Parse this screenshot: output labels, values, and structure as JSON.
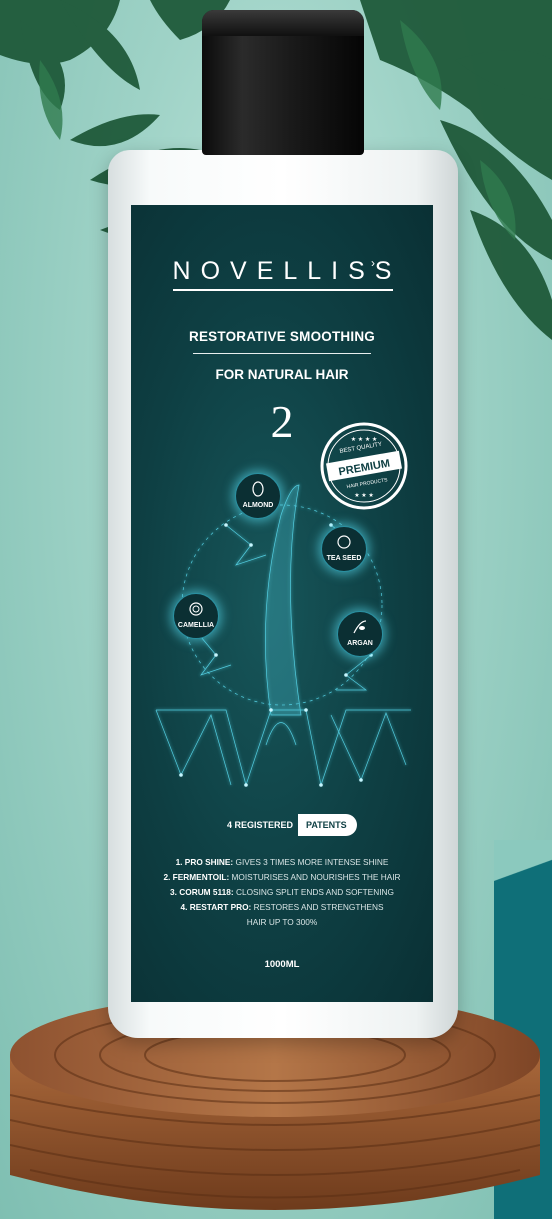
{
  "product": {
    "brand": "NOVELLISS",
    "title_line1": "RESTORATIVE SMOOTHING",
    "title_line2": "FOR NATURAL HAIR",
    "number": "2",
    "seal": {
      "top": "BEST QUALITY",
      "main": "PREMIUM",
      "bottom": "HAIR PRODUCTS"
    },
    "ingredients": [
      "ALMOND",
      "TEA SEED",
      "CAMELLIA",
      "ARGAN"
    ],
    "patents": {
      "count_label": "4 REGISTERED",
      "badge": "PATENTS"
    },
    "features": [
      {
        "name": "1. PRO SHINE:",
        "text": " GIVES 3 TIMES MORE INTENSE SHINE"
      },
      {
        "name": "2. FERMENTOIL:",
        "text": " MOISTURISES AND NOURISHES THE HAIR"
      },
      {
        "name": "3. CORUM 5118:",
        "text": " CLOSING SPLIT ENDS AND SOFTENING"
      },
      {
        "name": "4. RESTART PRO:",
        "text": " RESTORES AND STRENGTHENS HAIR UP TO 300%"
      }
    ],
    "volume": "1000ML"
  },
  "colors": {
    "label": "#0e3f43",
    "glow": "#5adcf0",
    "accent_block": "#0f6f78",
    "wood": "#9a5a2c"
  },
  "icons": [
    "almond-icon",
    "tea-seed-icon",
    "camellia-icon",
    "argan-icon",
    "hair-strand-icon",
    "leaf-icon"
  ]
}
